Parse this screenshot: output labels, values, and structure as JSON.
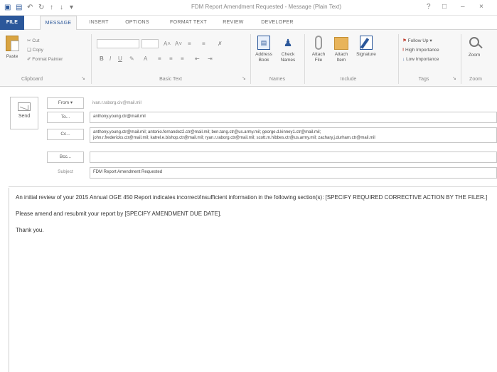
{
  "window": {
    "title": "FDM Report Amendment Requested - Message (Plain Text)",
    "controls": [
      "?",
      "□",
      "–",
      "×"
    ]
  },
  "tabs": [
    {
      "label": "FILE"
    },
    {
      "label": "MESSAGE"
    },
    {
      "label": "INSERT"
    },
    {
      "label": "OPTIONS"
    },
    {
      "label": "FORMAT TEXT"
    },
    {
      "label": "REVIEW"
    },
    {
      "label": "DEVELOPER"
    }
  ],
  "ribbon": {
    "clipboard": {
      "label": "Clipboard",
      "paste": "Paste",
      "cut": "Cut",
      "copy": "Copy",
      "format_painter": "Format Painter"
    },
    "basic_text": {
      "label": "Basic Text"
    },
    "names": {
      "label": "Names",
      "address_book": "Address\nBook",
      "check_names": "Check\nNames"
    },
    "include": {
      "label": "Include",
      "attach_file": "Attach\nFile",
      "attach_item": "Attach\nItem",
      "signature": "Signature"
    },
    "tags": {
      "label": "Tags",
      "follow_up": "Follow Up",
      "high_importance": "High Importance",
      "low_importance": "Low Importance"
    },
    "zoom": {
      "label": "Zoom",
      "zoom": "Zoom"
    }
  },
  "compose": {
    "send_label": "Send",
    "from_label": "From",
    "from_value": "ivan.r.raborg.civ@mail.mil",
    "to_label": "To...",
    "to_value": "anthony.young.ctr@mail.mil",
    "cc_label": "Cc...",
    "cc_line1": "anthony.young.ctr@mail.mil; antonio.fernandez2.ctr@mail.mil; ben.tang.ctr@us.army.mil; george.d.kinney1.ctr@mail.mil;",
    "cc_line2": "john.r.fredericks.ctr@mail.mil; katrel.e.bishop.ctr@mail.mil; ryan.r.raborg.ctr@mail.mil; scott.m.hibbes.ctr@us.army.mil; zachary.j.durham.ctr@mail.mil",
    "bcc_label": "Bcc...",
    "bcc_value": "",
    "subject_label": "Subject",
    "subject_value": "FDM Report Amendment Requested"
  },
  "body": {
    "p1": "An initial review of your 2015 Annual OGE 450 Report indicates incorrect/insufficient information in the following section(s): [SPECIFY REQUIRED CORRECTIVE ACTION BY THE FILER.]",
    "p2": "Please amend and resubmit your report by [SPECIFY AMENDMENT DUE DATE].",
    "p3": "Thank you."
  },
  "colors": {
    "accent": "#2b579a",
    "follow_up_flag": "#c0392b",
    "high_importance": "#c0392b",
    "low_importance": "#2b579a"
  }
}
